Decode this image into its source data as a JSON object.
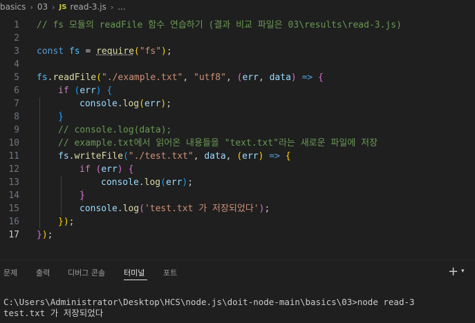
{
  "breadcrumb": {
    "folder1": "basics",
    "folder2": "03",
    "file_type": "JS",
    "file": "read-3.js",
    "more": "..."
  },
  "editor": {
    "active_line": 17,
    "line_numbers": [
      "1",
      "2",
      "3",
      "4",
      "5",
      "6",
      "7",
      "8",
      "9",
      "10",
      "11",
      "12",
      "13",
      "14",
      "15",
      "16",
      "17"
    ],
    "code": {
      "comment1": "// fs 모듈의 readFile 함수 연습하기 (결과 비교 파일은 03\\results\\read-3.js)",
      "kw_const": "const",
      "var_fs": "fs",
      "op_eq": "=",
      "fn_require": "require",
      "str_fs": "\"fs\"",
      "p_open": "(",
      "p_close": ")",
      "semi": ";",
      "fs": "fs",
      "dot": ".",
      "fn_readFile": "readFile",
      "str_example": "\"./example.txt\"",
      "comma": ",",
      "str_utf8": "\"utf8\"",
      "param_err": "err",
      "param_data": "data",
      "arrow": "=>",
      "brace_open": "{",
      "brace_close": "}",
      "kw_if": "if",
      "console": "console",
      "fn_log": "log",
      "comment9": "// console.log(data);",
      "comment10": "// example.txt에서 읽어온 내용들을 \"text.txt\"라는 새로운 파일에 저장",
      "fn_writeFile": "writeFile",
      "str_test": "\"./test.txt\"",
      "str_msg": "'test.txt 가 저장되었다'",
      "close_outer": "});"
    }
  },
  "panel": {
    "tabs": [
      "문제",
      "출력",
      "디버그 콘솔",
      "터미널",
      "포트"
    ],
    "active_tab": "터미널",
    "add_icon": "plus-icon",
    "dropdown_icon": "chevron-down-icon"
  },
  "terminal": {
    "line1": "C:\\Users\\Administrator\\Desktop\\HCS\\node.js\\doit-node-main\\basics\\03>node read-3",
    "line2": "test.txt 가 저장되었다"
  }
}
